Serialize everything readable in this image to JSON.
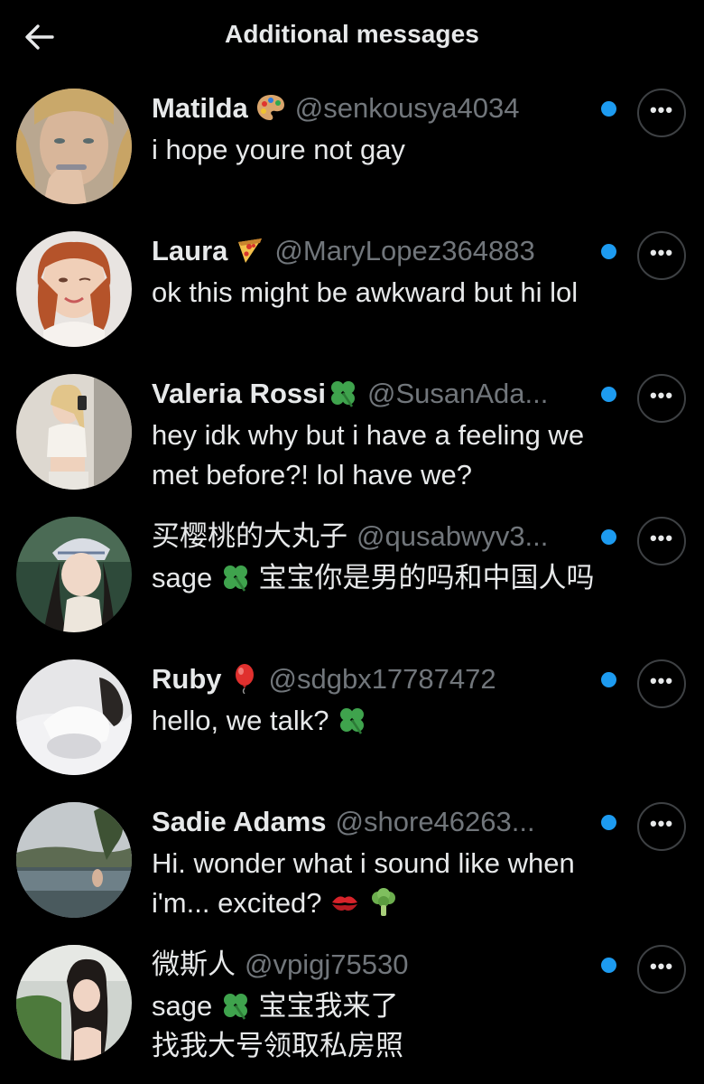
{
  "header": {
    "title": "Additional messages",
    "back_icon": "arrow-left-icon"
  },
  "colors": {
    "background": "#000000",
    "text": "#e7e9ea",
    "secondary": "#71767b",
    "unread_dot": "#1d9bf0"
  },
  "more_label": "•••",
  "messages": [
    {
      "name": "Matilda",
      "emoji": "artist-palette-icon",
      "handle": "@senkousya4034",
      "text": "i hope youre not gay",
      "unread": true
    },
    {
      "name": "Laura",
      "emoji": "pizza-icon",
      "handle": "@MaryLopez364883",
      "text": "ok this might be awkward but hi lol",
      "unread": true
    },
    {
      "name": "Valeria Rossi",
      "emoji": "four-leaf-clover-icon",
      "handle": "@SusanAda...",
      "text": "hey idk why but i have a feeling we met before?! lol have we?",
      "unread": true
    },
    {
      "name": "买樱桃的大丸子",
      "handle": "@qusabwyv3...",
      "text_before": "sage",
      "inline_emoji": "four-leaf-clover-icon",
      "text_after": "宝宝你是男的吗和中国人吗",
      "unread": true
    },
    {
      "name": "Ruby",
      "emoji": "balloon-icon",
      "handle": "@sdgbx17787472",
      "text_before": "hello, we talk?",
      "inline_emoji": "four-leaf-clover-icon",
      "unread": true
    },
    {
      "name": "Sadie Adams",
      "handle": "@shore46263...",
      "text_before": "Hi. wonder what i sound like when i'm... excited?",
      "inline_emoji": "kiss-mark-icon",
      "inline_emoji_2": "broccoli-icon",
      "unread": true
    },
    {
      "name": "微斯人",
      "handle": "@vpigj75530",
      "text_before": "sage",
      "inline_emoji": "four-leaf-clover-icon",
      "text_after": "宝宝我来了",
      "text_line2": "找我大号领取私房照",
      "unread": true
    }
  ]
}
